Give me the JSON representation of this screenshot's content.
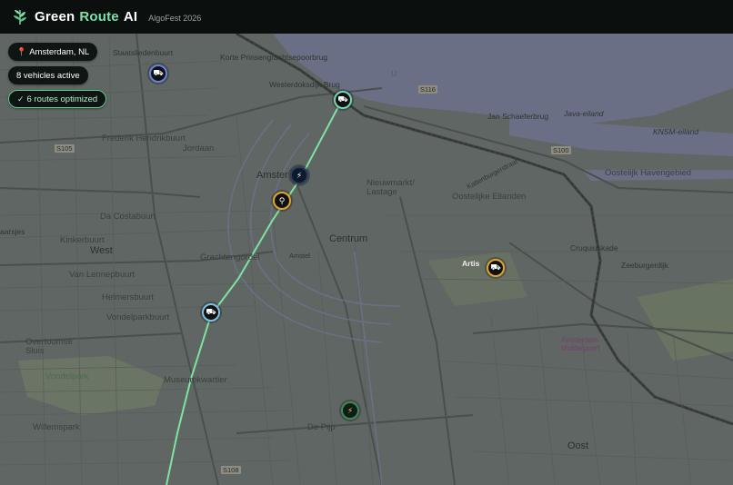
{
  "header": {
    "brand_green": "Green",
    "brand_route": "Route",
    "brand_ai": "AI",
    "tagline": "AlgoFest 2026"
  },
  "overlay": {
    "location": "Amsterdam, NL",
    "vehicles": "8 vehicles active",
    "routes": "6 routes optimized",
    "location_icon": "pin-icon",
    "check_icon": "check-icon"
  },
  "colors": {
    "accent": "#7ee2a8",
    "route_line": "#7fe3a4",
    "marker_orange": "#e0a52a",
    "marker_blue": "#6b7fe0",
    "marker_teal": "#74d6b7"
  },
  "map": {
    "labels": {
      "staatsliedenbuurt": "Staatsliedenbuurt",
      "korte": "Korte Prinsengrachtsepoorbrug",
      "westerdoks": "Westerdoksdijk Brug",
      "frederik": "Frederik Hendrikbuurt",
      "jordaan": "Jordaan",
      "amster": "Amster",
      "nieuwmarkt": "Nieuwmarkt/\nLastage",
      "oostelijke": "Oostelijke Eilanden",
      "oostelijkhaven": "Oostelijk Havengebied",
      "dacosta": "Da Costabuurt",
      "kinker": "Kinkerbuurt",
      "west": "West",
      "vanlennep": "Van Lennepbuurt",
      "helmers": "Helmersbuurt",
      "vondelparkbuurt": "Vondelparkbuurt",
      "grachtengordel": "Grachtengordel",
      "centrum": "Centrum",
      "artis": "Artis",
      "overtoomse": "Overtoomse\nSluis",
      "vondelpark": "Vondelpark",
      "museum": "Museumkwartier",
      "willemspark": "Willemspark",
      "depijp": "De Pijp",
      "amsterdam_museumpoort": "Amsterdam\nMuiderpoort",
      "oost": "Oost",
      "janschaefer": "Jan Schaeferbrug",
      "java": "Java-eiland",
      "knsm": "KNSM-eiland",
      "cruquius": "Cruquiuskade",
      "zeeburgerdijk": "Zeeburgerdijk",
      "s116": "S116",
      "s100": "S100",
      "s105": "S105",
      "s108": "S108",
      "aarsjes": "aarsjes",
      "lastage_k": "Kattenburgerstraat",
      "amstel": "Amstel",
      "ij": "IJ"
    }
  },
  "markers": [
    {
      "name": "marker-vehicle-staats",
      "glyph": "⛟"
    },
    {
      "name": "marker-vehicle-westerdok",
      "glyph": "⛟"
    },
    {
      "name": "marker-charging-centraal",
      "glyph": "⚡"
    },
    {
      "name": "marker-bike-dam",
      "glyph": "⚲"
    },
    {
      "name": "marker-vehicle-artis",
      "glyph": "⛟"
    },
    {
      "name": "marker-vehicle-vondel",
      "glyph": "⛟"
    },
    {
      "name": "marker-charging-pijp",
      "glyph": "⚡"
    }
  ]
}
